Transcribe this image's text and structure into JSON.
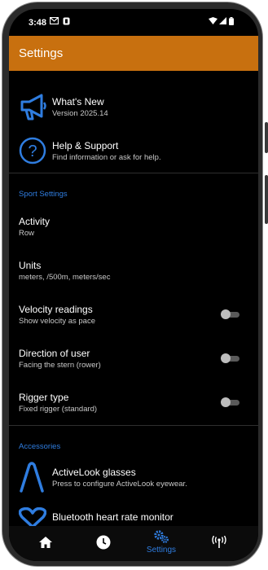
{
  "status_bar": {
    "time": "3:48",
    "icons": [
      "gmail-icon",
      "nfc-icon",
      "wifi-icon",
      "signal-icon",
      "battery-icon"
    ]
  },
  "header": {
    "title": "Settings"
  },
  "top_items": [
    {
      "icon": "megaphone-icon",
      "title": "What's New",
      "subtitle": "Version 2025.14"
    },
    {
      "icon": "help-icon",
      "title": "Help & Support",
      "subtitle": "Find information or ask for help."
    }
  ],
  "sport_settings": {
    "section_title": "Sport Settings",
    "items": [
      {
        "title": "Activity",
        "subtitle": "Row"
      },
      {
        "title": "Units",
        "subtitle": "meters, /500m, meters/sec"
      },
      {
        "title": "Velocity readings",
        "subtitle": "Show velocity as pace",
        "toggle": false
      },
      {
        "title": "Direction of user",
        "subtitle": "Facing the stern (rower)",
        "toggle": false
      },
      {
        "title": "Rigger type",
        "subtitle": "Fixed rigger (standard)",
        "toggle": false
      }
    ]
  },
  "accessories": {
    "section_title": "Accessories",
    "items": [
      {
        "icon": "activelook-icon",
        "title": "ActiveLook glasses",
        "subtitle": "Press to configure ActiveLook eyewear."
      },
      {
        "icon": "heart-icon",
        "title": "Bluetooth heart rate monitor",
        "subtitle": ""
      }
    ]
  },
  "bottom_nav": {
    "items": [
      {
        "icon": "home-icon",
        "label": ""
      },
      {
        "icon": "clock-icon",
        "label": ""
      },
      {
        "icon": "gears-icon",
        "label": "Settings",
        "selected": true
      },
      {
        "icon": "antenna-icon",
        "label": ""
      }
    ]
  },
  "colors": {
    "header": "#c8700f",
    "accent": "#2f7de0",
    "background": "#000000"
  }
}
